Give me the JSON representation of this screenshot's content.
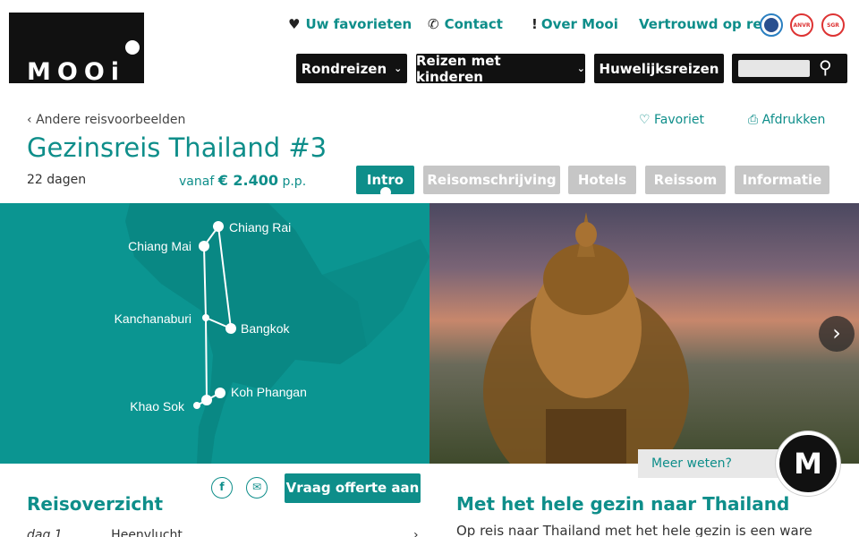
{
  "brand": {
    "logo_text": "MOOi"
  },
  "toplinks": {
    "favorites": "Uw favorieten",
    "contact": "Contact",
    "about": "Over Mooi",
    "trust": "Vertrouwd op reis",
    "cert_labels": [
      "",
      "ANVR",
      "SGR"
    ]
  },
  "nav": {
    "rondreizen": "Rondreizen",
    "kinderen": "Reizen met kinderen",
    "huwelijk": "Huwelijksreizen"
  },
  "trip": {
    "back": "Andere reisvoorbeelden",
    "title": "Gezinsreis Thailand #3",
    "duration": "22 dagen",
    "price_prefix": "vanaf",
    "price": "€ 2.400",
    "price_suffix": "p.p.",
    "favorite": "Favoriet",
    "print": "Afdrukken"
  },
  "tabs": [
    {
      "label": "Intro",
      "active": true
    },
    {
      "label": "Reisomschrijving",
      "active": false
    },
    {
      "label": "Hotels",
      "active": false
    },
    {
      "label": "Reissom",
      "active": false
    },
    {
      "label": "Informatie",
      "active": false
    }
  ],
  "map": {
    "places": [
      "Chiang Rai",
      "Chiang Mai",
      "Kanchanaburi",
      "Bangkok",
      "Koh Phangan",
      "Khao Sok"
    ]
  },
  "help": {
    "more": "Meer weten?",
    "badge": "M"
  },
  "overview": {
    "title": "Reisoverzicht",
    "share_fb": "f",
    "share_mail": "✉",
    "quote_button": "Vraag offerte aan",
    "first_day": "dag 1",
    "first_item": "Heenvlucht"
  },
  "intro": {
    "title": "Met het hele gezin naar Thailand",
    "text": "Op reis naar Thailand met het hele gezin is een ware"
  },
  "colors": {
    "accent": "#0e8e8a",
    "dark": "#111111",
    "tab_inactive": "#c6c6c6"
  }
}
